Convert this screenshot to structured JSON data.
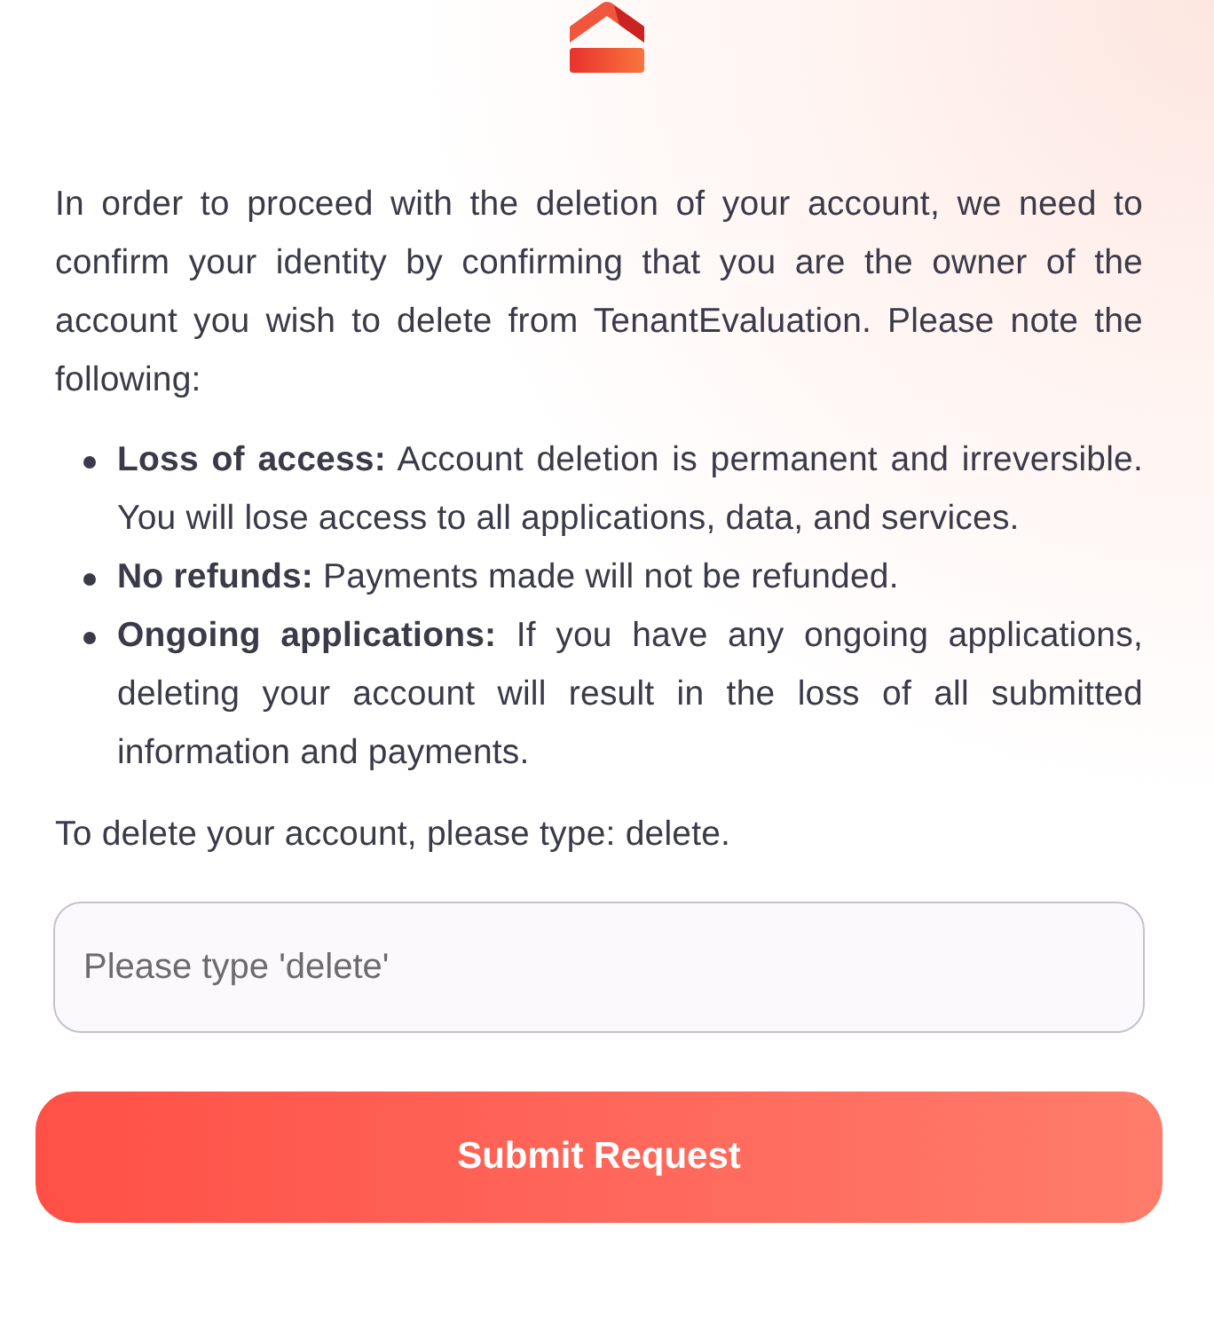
{
  "intro": "In order to proceed with the deletion of your account, we need to confirm your identity by confirming that you are the owner of the account you wish to delete from TenantEvaluation. Please note the following:",
  "notes": [
    {
      "text": "**Loss of access:** Account deletion is permanent and irreversible. You will lose access to all applications, data, and services."
    },
    {
      "text": "**No refunds:** Payments made will not be refunded."
    },
    {
      "text": "**Ongoing applications:** If you have any ongoing applications, deleting your account will result in the loss of all submitted information and payments."
    }
  ],
  "instruction": "To delete your account, please type: delete.",
  "confirm_field": {
    "placeholder": "Please type 'delete'"
  },
  "submit_button": "Submit Request"
}
